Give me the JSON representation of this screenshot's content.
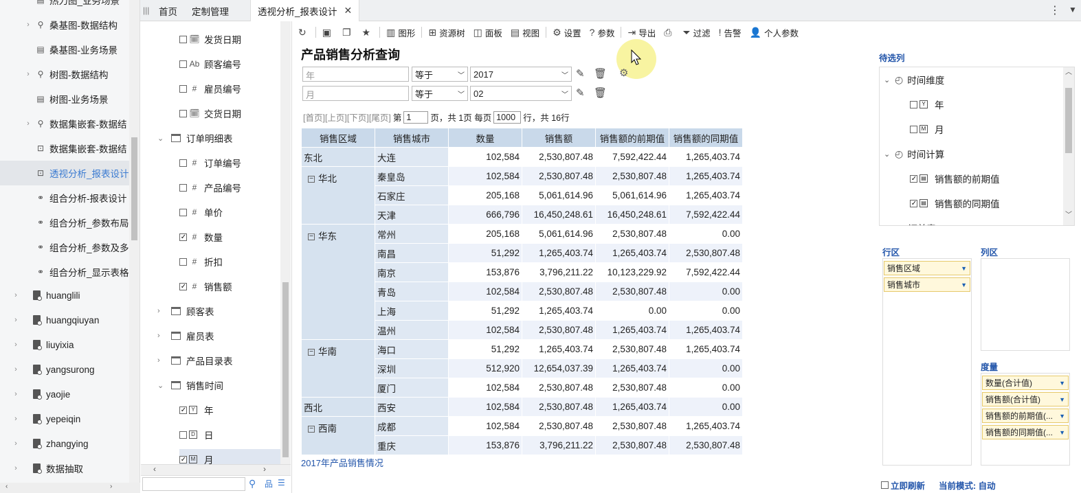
{
  "left_nav": {
    "items": [
      {
        "label": "热力图_业务场景",
        "arrow": "",
        "icon": "report-icon"
      },
      {
        "label": "桑基图-数据结构",
        "arrow": "›",
        "icon": "query-icon"
      },
      {
        "label": "桑基图-业务场景",
        "arrow": "",
        "icon": "report-icon"
      },
      {
        "label": "树图-数据结构",
        "arrow": "›",
        "icon": "query-icon"
      },
      {
        "label": "树图-业务场景",
        "arrow": "",
        "icon": "report-icon"
      },
      {
        "label": "数据集嵌套-数据结",
        "arrow": "›",
        "icon": "query-icon"
      },
      {
        "label": "数据集嵌套-数据结",
        "arrow": "",
        "icon": "pivot-icon"
      },
      {
        "label": "透视分析_报表设计",
        "arrow": "",
        "icon": "pivot-icon",
        "selected": true
      },
      {
        "label": "组合分析-报表设计",
        "arrow": "",
        "icon": "combo-icon"
      },
      {
        "label": "组合分析_参数布局",
        "arrow": "",
        "icon": "combo-icon"
      },
      {
        "label": "组合分析_参数及多",
        "arrow": "",
        "icon": "combo-icon"
      },
      {
        "label": "组合分析_显示表格",
        "arrow": "",
        "icon": "combo-icon"
      }
    ],
    "users": [
      "huanglili",
      "huangqiuyan",
      "liuyixia",
      "yangsurong",
      "yaojie",
      "yepeiqin",
      "zhangying",
      "数据抽取"
    ]
  },
  "tabs": {
    "home": "首页",
    "custom": "定制管理",
    "active": "透视分析_报表设计"
  },
  "field_tree": {
    "items": [
      {
        "label": "发货日期",
        "type": "date",
        "checked": false,
        "indent": 2
      },
      {
        "label": "顾客编号",
        "type": "text",
        "checked": false,
        "indent": 2
      },
      {
        "label": "雇员编号",
        "type": "number",
        "checked": false,
        "indent": 2
      },
      {
        "label": "交货日期",
        "type": "date",
        "checked": false,
        "indent": 2
      },
      {
        "label": "订单明细表",
        "type": "table",
        "expanded": true,
        "indent": 1
      },
      {
        "label": "订单编号",
        "type": "number",
        "checked": false,
        "indent": 2
      },
      {
        "label": "产品编号",
        "type": "number",
        "checked": false,
        "indent": 2
      },
      {
        "label": "单价",
        "type": "number",
        "checked": false,
        "indent": 2
      },
      {
        "label": "数量",
        "type": "number",
        "checked": true,
        "indent": 2
      },
      {
        "label": "折扣",
        "type": "number",
        "checked": false,
        "indent": 2
      },
      {
        "label": "销售额",
        "type": "number",
        "checked": true,
        "indent": 2
      },
      {
        "label": "顾客表",
        "type": "table",
        "expanded": false,
        "indent": 1
      },
      {
        "label": "雇员表",
        "type": "table",
        "expanded": false,
        "indent": 1
      },
      {
        "label": "产品目录表",
        "type": "table",
        "expanded": false,
        "indent": 1
      },
      {
        "label": "销售时间",
        "type": "table",
        "expanded": true,
        "indent": 1
      },
      {
        "label": "年",
        "type": "year",
        "checked": true,
        "indent": 2
      },
      {
        "label": "日",
        "type": "day",
        "checked": false,
        "indent": 2
      },
      {
        "label": "月",
        "type": "month",
        "checked": true,
        "indent": 2,
        "selected": true
      }
    ]
  },
  "toolbar": {
    "chart": "图形",
    "resource_tree": "资源树",
    "panel": "面板",
    "view": "视图",
    "settings": "设置",
    "params": "参数",
    "export": "导出",
    "filter": "过滤",
    "alert": "告警",
    "personal_params": "个人参数"
  },
  "report": {
    "title": "产品销售分析查询",
    "filters": [
      {
        "field_placeholder": "年",
        "operator": "等于",
        "value": "2017"
      },
      {
        "field_placeholder": "月",
        "operator": "等于",
        "value": "02"
      }
    ],
    "pager": {
      "first": "[首页]",
      "prev": "[上页]",
      "next": "[下页]",
      "last": "[尾页]",
      "page_prefix": "第",
      "page": "1",
      "page_suffix": "页，共 1页 每页",
      "per_page": "1000",
      "rows_suffix": "行，共 16行"
    },
    "columns": [
      "销售区域",
      "销售城市",
      "数量",
      "销售额",
      "销售额的前期值",
      "销售额的同期值"
    ],
    "groups": [
      {
        "region": "东北",
        "collapsible": false,
        "rows": [
          {
            "city": "大连",
            "qty": "102,584",
            "sales": "2,530,807.48",
            "prev": "7,592,422.44",
            "same": "1,265,403.74"
          }
        ]
      },
      {
        "region": "华北",
        "collapsible": true,
        "rows": [
          {
            "city": "秦皇岛",
            "qty": "102,584",
            "sales": "2,530,807.48",
            "prev": "2,530,807.48",
            "same": "1,265,403.74"
          },
          {
            "city": "石家庄",
            "qty": "205,168",
            "sales": "5,061,614.96",
            "prev": "5,061,614.96",
            "same": "1,265,403.74"
          },
          {
            "city": "天津",
            "qty": "666,796",
            "sales": "16,450,248.61",
            "prev": "16,450,248.61",
            "same": "7,592,422.44"
          }
        ]
      },
      {
        "region": "华东",
        "collapsible": true,
        "rows": [
          {
            "city": "常州",
            "qty": "205,168",
            "sales": "5,061,614.96",
            "prev": "2,530,807.48",
            "same": "0.00"
          },
          {
            "city": "南昌",
            "qty": "51,292",
            "sales": "1,265,403.74",
            "prev": "1,265,403.74",
            "same": "2,530,807.48"
          },
          {
            "city": "南京",
            "qty": "153,876",
            "sales": "3,796,211.22",
            "prev": "10,123,229.92",
            "same": "7,592,422.44"
          },
          {
            "city": "青岛",
            "qty": "102,584",
            "sales": "2,530,807.48",
            "prev": "2,530,807.48",
            "same": "0.00"
          },
          {
            "city": "上海",
            "qty": "51,292",
            "sales": "1,265,403.74",
            "prev": "0.00",
            "same": "0.00"
          },
          {
            "city": "温州",
            "qty": "102,584",
            "sales": "2,530,807.48",
            "prev": "1,265,403.74",
            "same": "1,265,403.74"
          }
        ]
      },
      {
        "region": "华南",
        "collapsible": true,
        "rows": [
          {
            "city": "海口",
            "qty": "51,292",
            "sales": "1,265,403.74",
            "prev": "2,530,807.48",
            "same": "1,265,403.74"
          },
          {
            "city": "深圳",
            "qty": "512,920",
            "sales": "12,654,037.39",
            "prev": "1,265,403.74",
            "same": "0.00"
          },
          {
            "city": "厦门",
            "qty": "102,584",
            "sales": "2,530,807.48",
            "prev": "2,530,807.48",
            "same": "0.00"
          }
        ]
      },
      {
        "region": "西北",
        "collapsible": false,
        "rows": [
          {
            "city": "西安",
            "qty": "102,584",
            "sales": "2,530,807.48",
            "prev": "1,265,403.74",
            "same": "0.00"
          }
        ]
      },
      {
        "region": "西南",
        "collapsible": true,
        "rows": [
          {
            "city": "成都",
            "qty": "102,584",
            "sales": "2,530,807.48",
            "prev": "2,530,807.48",
            "same": "1,265,403.74"
          },
          {
            "city": "重庆",
            "qty": "153,876",
            "sales": "3,796,211.22",
            "prev": "2,530,807.48",
            "same": "2,530,807.48"
          }
        ]
      }
    ],
    "footnote": "2017年产品销售情况"
  },
  "right_panel": {
    "candidates_title": "待选列",
    "tree": [
      {
        "label": "时间维度",
        "kind": "folder",
        "indent": 0
      },
      {
        "label": "年",
        "kind": "year",
        "checked": false,
        "indent": 1
      },
      {
        "label": "月",
        "kind": "month",
        "checked": false,
        "indent": 1
      },
      {
        "label": "时间计算",
        "kind": "folder",
        "indent": 0
      },
      {
        "label": "销售额的前期值",
        "kind": "calc",
        "checked": true,
        "indent": 1
      },
      {
        "label": "销售额的同期值",
        "kind": "calc",
        "checked": true,
        "indent": 1
      },
      {
        "label": "订单表",
        "kind": "table",
        "indent": 0
      }
    ],
    "row_zone_title": "行区",
    "col_zone_title": "列区",
    "measure_zone_title": "度量",
    "row_fields": [
      "销售区域",
      "销售城市"
    ],
    "measures": [
      "数量(合计值)",
      "销售额(合计值)",
      "销售额的前期值(...",
      "销售额的同期值(..."
    ],
    "auto_refresh": "立即刷新",
    "mode": "当前模式: 自动"
  },
  "colors": {
    "accent": "#2255aa",
    "header": "#c9d9ea",
    "chip_bg": "#fff8dc"
  }
}
